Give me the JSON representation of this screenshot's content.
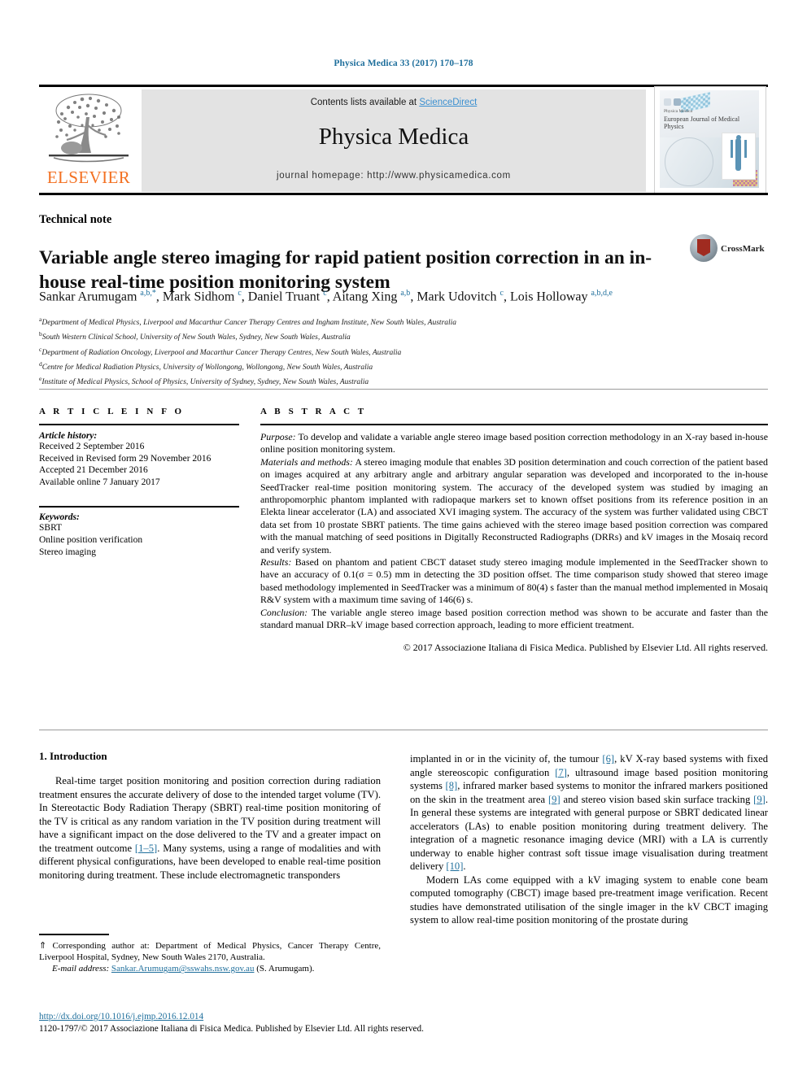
{
  "running_head": "Physica Medica 33 (2017) 170–178",
  "masthead": {
    "contents_prefix": "Contents lists available at ",
    "sciencedirect": "ScienceDirect",
    "journal_title": "Physica Medica",
    "homepage": "journal homepage: http://www.physicamedica.com",
    "publisher_logo_text": "ELSEVIER",
    "cover_title_small": "Physica Medica",
    "cover_title_main": "European Journal of Medical Physics"
  },
  "article": {
    "type": "Technical note",
    "title": "Variable angle stereo imaging for rapid patient position correction in an in-house real-time position monitoring system",
    "crossmark_label": "CrossMark",
    "authors_html": "Sankar Arumugam <sup>a,b,*</sup>, Mark Sidhom <sup>c</sup>, Daniel Truant <sup>c</sup>, Aitang Xing <sup>a,b</sup>, Mark Udovitch <sup>c</sup>, Lois Holloway <sup>a,b,d,e</sup>",
    "affiliations": [
      "a Department of Medical Physics, Liverpool and Macarthur Cancer Therapy Centres and Ingham Institute, New South Wales, Australia",
      "b South Western Clinical School, University of New South Wales, Sydney, New South Wales, Australia",
      "c Department of Radiation Oncology, Liverpool and Macarthur Cancer Therapy Centres, New South Wales, Australia",
      "d Centre for Medical Radiation Physics, University of Wollongong, Wollongong, New South Wales, Australia",
      "e Institute of Medical Physics, School of Physics, University of Sydney, Sydney, New South Wales, Australia"
    ]
  },
  "article_info": {
    "heading": "A R T I C L E   I N F O",
    "history_label": "Article history:",
    "history": [
      "Received 2 September 2016",
      "Received in Revised form 29 November 2016",
      "Accepted 21 December 2016",
      "Available online 7 January 2017"
    ],
    "keywords_label": "Keywords:",
    "keywords": [
      "SBRT",
      "Online position verification",
      "Stereo imaging"
    ]
  },
  "abstract": {
    "heading": "A B S T R A C T",
    "purpose_label": "Purpose:",
    "purpose_text": " To develop and validate a variable angle stereo image based position correction methodology in an X-ray based in-house online position monitoring system.",
    "methods_label": "Materials and methods:",
    "methods_text": " A stereo imaging module that enables 3D position determination and couch correction of the patient based on images acquired at any arbitrary angle and arbitrary angular separation was developed and incorporated to the in-house SeedTracker real-time position monitoring system. The accuracy of the developed system was studied by imaging an anthropomorphic phantom implanted with radiopaque markers set to known offset positions from its reference position in an Elekta linear accelerator (LA) and associated XVI imaging system. The accuracy of the system was further validated using CBCT data set from 10 prostate SBRT patients. The time gains achieved with the stereo image based position correction was compared with the manual matching of seed positions in Digitally Reconstructed Radiographs (DRRs) and kV images in the Mosaiq record and verify system.",
    "results_label": "Results:",
    "results_text": " Based on phantom and patient CBCT dataset study stereo imaging module implemented in the SeedTracker shown to have an accuracy of 0.1(σ = 0.5) mm in detecting the 3D position offset. The time comparison study showed that stereo image based methodology implemented in SeedTracker was a minimum of 80(4) s faster than the manual method implemented in Mosaiq R&V system with a maximum time saving of 146(6) s.",
    "conclusion_label": "Conclusion:",
    "conclusion_text": " The variable angle stereo image based position correction method was shown to be accurate and faster than the standard manual DRR–kV image based correction approach, leading to more efficient treatment.",
    "copyright": "© 2017 Associazione Italiana di Fisica Medica. Published by Elsevier Ltd. All rights reserved."
  },
  "body": {
    "section_title": "1. Introduction",
    "left_paragraph_1_a": "Real-time target position monitoring and position correction during radiation treatment ensures the accurate delivery of dose to the intended target volume (TV). In Stereotactic Body Radiation Therapy (SBRT) real-time position monitoring of the TV is critical as any random variation in the TV position during treatment will have a significant impact on the dose delivered to the TV and a greater impact on the treatment outcome ",
    "left_ref_1": "[1–5]",
    "left_paragraph_1_b": ". Many systems, using a range of modalities and with different physical configurations, have been developed to enable real-time position monitoring during treatment. These include electromagnetic transponders",
    "right_frag_1": "implanted in or in the vicinity of, the tumour ",
    "right_ref_6": "[6]",
    "right_frag_2": ", kV X-ray based systems with fixed angle stereoscopic configuration ",
    "right_ref_7": "[7]",
    "right_frag_3": ", ultrasound image based position monitoring systems ",
    "right_ref_8": "[8]",
    "right_frag_4": ", infrared marker based systems to monitor the infrared markers positioned on the skin in the treatment area ",
    "right_ref_9a": "[9]",
    "right_frag_5": " and stereo vision based skin surface tracking ",
    "right_ref_9b": "[9]",
    "right_frag_6": ". In general these systems are integrated with general purpose or SBRT dedicated linear accelerators (LAs) to enable position monitoring during treatment delivery. The integration of a magnetic resonance imaging device (MRI) with a LA is currently underway to enable higher contrast soft tissue image visualisation during treatment delivery ",
    "right_ref_10": "[10]",
    "right_frag_7": ".",
    "right_paragraph_2": "Modern LAs come equipped with a kV imaging system to enable cone beam computed tomography (CBCT) image based pre-treatment image verification. Recent studies have demonstrated utilisation of the single imager in the kV CBCT imaging system to allow real-time position monitoring of the prostate during"
  },
  "footnotes": {
    "corresponding": "⇑ Corresponding author at: Department of Medical Physics, Cancer Therapy Centre, Liverpool Hospital, Sydney, New South Wales 2170, Australia.",
    "email_label": "E-mail address:",
    "email": "Sankar.Arumugam@sswahs.nsw.gov.au",
    "email_suffix": " (S. Arumugam).",
    "doi": "http://dx.doi.org/10.1016/j.ejmp.2016.12.014",
    "issn_line": "1120-1797/© 2017 Associazione Italiana di Fisica Medica. Published by Elsevier Ltd. All rights reserved."
  },
  "colors": {
    "link_blue": "#1f6f9c",
    "sciencedirect_blue": "#3a8fd0",
    "elsevier_orange": "#F37021",
    "band_gray": "#e3e3e3"
  }
}
